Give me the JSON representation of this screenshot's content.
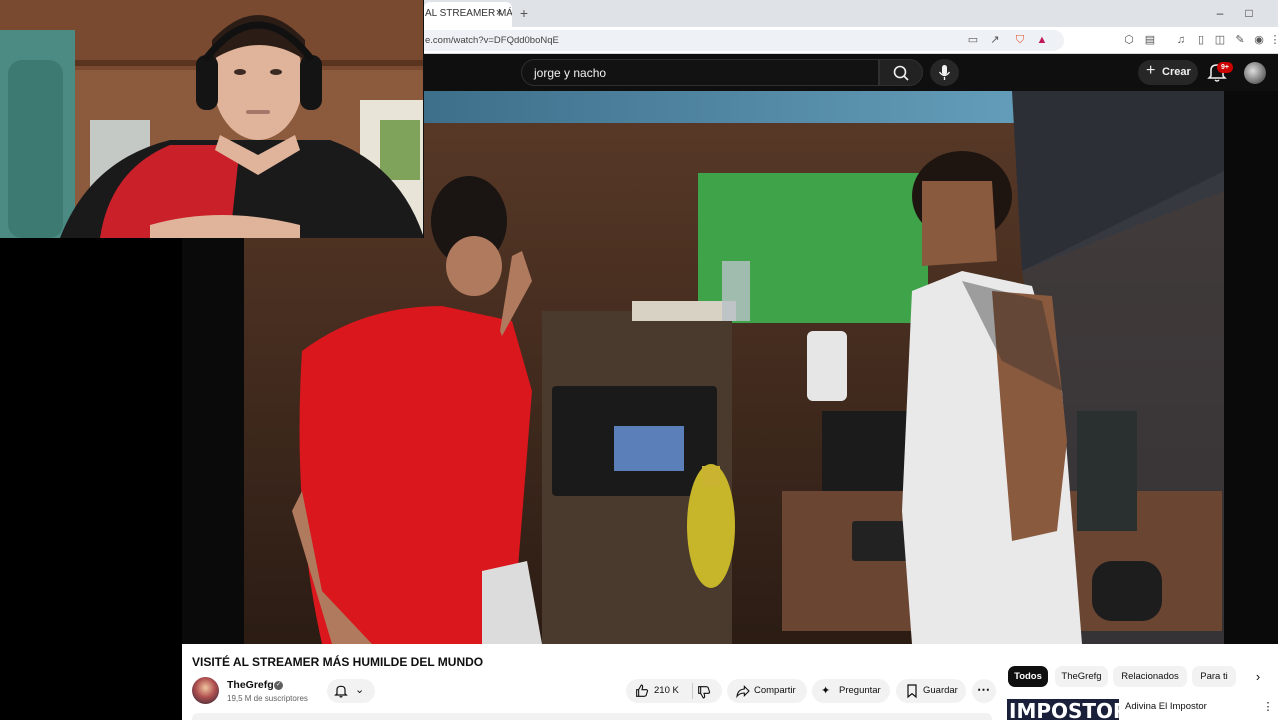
{
  "browser": {
    "tab_title": "AL STREAMER MÁ",
    "tab_close": "×",
    "new_tab": "+",
    "url": "e.com/watch?v=DFQdd0boNqE",
    "window_minimize": "–",
    "window_maximize": "□"
  },
  "youtube": {
    "search_query": "jorge y nacho",
    "create_label": "Crear",
    "notifications_badge": "9+"
  },
  "video": {
    "title": "VISITÉ AL STREAMER MÁS HUMILDE DEL MUNDO",
    "channel_name": "TheGrefg",
    "subscribers": "19,5 M de suscriptores",
    "likes": "210 K",
    "share_label": "Compartir",
    "ask_label": "Preguntar",
    "save_label": "Guardar"
  },
  "sidebar": {
    "chips": [
      "Todos",
      "TheGrefg",
      "Relacionados",
      "Para ti"
    ],
    "next_thumbnail_text": "IMPOSTOR",
    "next_title": "Adivina El Impostor"
  },
  "colors": {
    "yt_dark": "#0f0f0f",
    "accent_red": "#cc0000",
    "chip_bg": "#f2f2f2"
  }
}
